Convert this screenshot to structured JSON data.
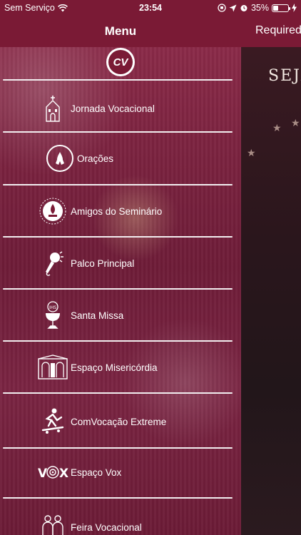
{
  "status_bar": {
    "carrier": "Sem Serviço",
    "time": "23:54",
    "battery": "35%",
    "battery_level": 0.35
  },
  "nav": {
    "menu_title": "Menu",
    "right_title": "Required"
  },
  "main": {
    "heading": "SEJA"
  },
  "logo": {
    "text": "CV"
  },
  "menu": {
    "items": [
      {
        "label": "Jornada Vocacional",
        "icon": "church-icon"
      },
      {
        "label": "Orações",
        "icon": "praying-hands-icon"
      },
      {
        "label": "Amigos do Seminário",
        "icon": "amigos-seminario-icon"
      },
      {
        "label": "Palco Principal",
        "icon": "microphone-icon"
      },
      {
        "label": "Santa Missa",
        "icon": "chalice-icon"
      },
      {
        "label": "Espaço Misericórdia",
        "icon": "confessional-icon"
      },
      {
        "label": "ComVocação Extreme",
        "icon": "skateboarder-icon"
      },
      {
        "label": "Espaço Vox",
        "icon": "vox-logo-icon"
      },
      {
        "label": "Feira Vocacional",
        "icon": "people-icon"
      }
    ]
  },
  "colors": {
    "bar": "#7a1a35",
    "drawer": "#7c2340",
    "divider": "#f2eef0"
  }
}
